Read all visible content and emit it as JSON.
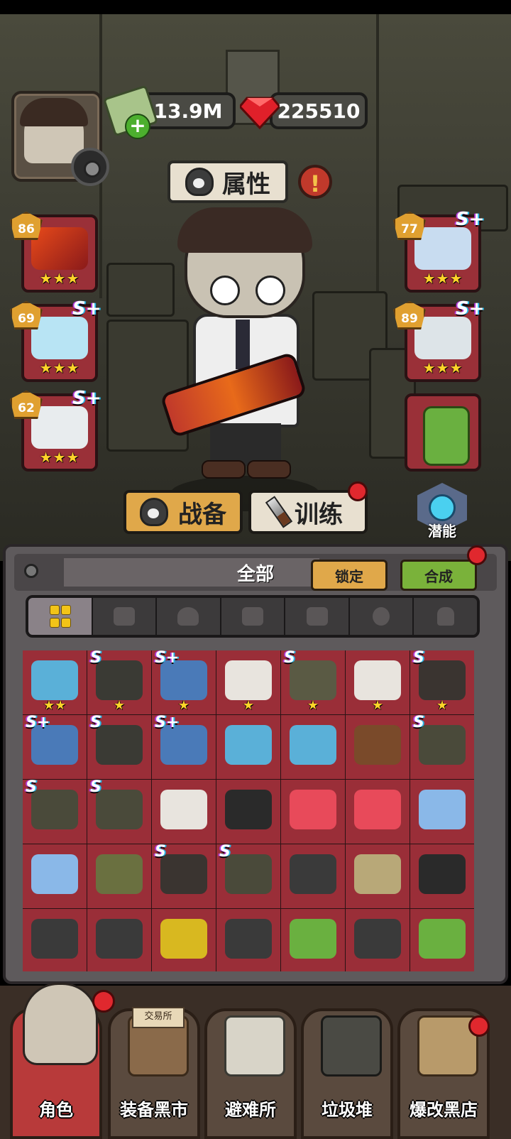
{
  "header": {
    "money": "13.9M",
    "gems": "225510"
  },
  "attributes_button": "属性",
  "equipped": {
    "left": [
      {
        "name": "flame-rifle",
        "level": "86",
        "grade": "",
        "stars": "★★★"
      },
      {
        "name": "visor-helmet",
        "level": "69",
        "grade": "S+",
        "stars": "★★★"
      },
      {
        "name": "white-sneaker",
        "level": "62",
        "grade": "S+",
        "stars": "★★★"
      }
    ],
    "right": [
      {
        "name": "blue-armor",
        "level": "77",
        "grade": "S+",
        "stars": "★★★"
      },
      {
        "name": "white-helmet",
        "level": "89",
        "grade": "S+",
        "stars": "★★★"
      },
      {
        "name": "green-backpack",
        "level": "",
        "grade": "",
        "stars": ""
      }
    ]
  },
  "tabs": {
    "gear": "战备",
    "training": "训练",
    "potential": "潜能"
  },
  "inventory": {
    "title": "全部",
    "lock_button": "锁定",
    "craft_button": "合成",
    "filters": [
      "all",
      "gun",
      "helmet",
      "pants",
      "armor",
      "mask",
      "backpack"
    ],
    "items": [
      {
        "grade": "",
        "stars": "★★",
        "color": "#5ab0d8"
      },
      {
        "grade": "S",
        "stars": "★",
        "color": "#3a3a34"
      },
      {
        "grade": "S+",
        "stars": "★",
        "color": "#4a7ab8"
      },
      {
        "grade": "",
        "stars": "★",
        "color": "#e8e4de"
      },
      {
        "grade": "S",
        "stars": "★",
        "color": "#5a5a44"
      },
      {
        "grade": "",
        "stars": "★",
        "color": "#e8e4de"
      },
      {
        "grade": "S",
        "stars": "★",
        "color": "#3a3430"
      },
      {
        "grade": "S+",
        "stars": "",
        "color": "#4a7ab8"
      },
      {
        "grade": "S",
        "stars": "",
        "color": "#3a3a34"
      },
      {
        "grade": "S+",
        "stars": "",
        "color": "#4a7ab8"
      },
      {
        "grade": "",
        "stars": "",
        "color": "#5ab0d8"
      },
      {
        "grade": "",
        "stars": "",
        "color": "#5ab0d8"
      },
      {
        "grade": "",
        "stars": "",
        "color": "#7a4a2a"
      },
      {
        "grade": "S",
        "stars": "",
        "color": "#4a4a3a"
      },
      {
        "grade": "S",
        "stars": "",
        "color": "#4a4a3a"
      },
      {
        "grade": "S",
        "stars": "",
        "color": "#4a4a3a"
      },
      {
        "grade": "",
        "stars": "",
        "color": "#e8e4de"
      },
      {
        "grade": "",
        "stars": "",
        "color": "#2a2a2a"
      },
      {
        "grade": "",
        "stars": "",
        "color": "#e84a5a"
      },
      {
        "grade": "",
        "stars": "",
        "color": "#e84a5a"
      },
      {
        "grade": "",
        "stars": "",
        "color": "#8ab8e8"
      },
      {
        "grade": "",
        "stars": "",
        "color": "#8ab8e8"
      },
      {
        "grade": "",
        "stars": "",
        "color": "#6a7040"
      },
      {
        "grade": "S",
        "stars": "",
        "color": "#3a3430"
      },
      {
        "grade": "S",
        "stars": "",
        "color": "#4a4a3a"
      },
      {
        "grade": "",
        "stars": "",
        "color": "#3a3a3a"
      },
      {
        "grade": "",
        "stars": "",
        "color": "#b8a878"
      },
      {
        "grade": "",
        "stars": "",
        "color": "#2a2a2a"
      },
      {
        "grade": "",
        "stars": "",
        "color": "#3a3a3a"
      },
      {
        "grade": "",
        "stars": "",
        "color": "#3a3a3a"
      },
      {
        "grade": "",
        "stars": "",
        "color": "#d8b820"
      },
      {
        "grade": "",
        "stars": "",
        "color": "#3a3a3a"
      },
      {
        "grade": "",
        "stars": "",
        "color": "#6ab040"
      },
      {
        "grade": "",
        "stars": "",
        "color": "#3a3a3a"
      },
      {
        "grade": "",
        "stars": "",
        "color": "#6ab040"
      }
    ]
  },
  "bottom_nav": [
    {
      "label": "角色",
      "sign": ""
    },
    {
      "label": "装备黑市",
      "sign": "交易所"
    },
    {
      "label": "避难所",
      "sign": ""
    },
    {
      "label": "垃圾堆",
      "sign": ""
    },
    {
      "label": "爆改黑店",
      "sign": ""
    }
  ],
  "colors": {
    "slot_red": "#9a2e38",
    "lock_btn": "#e0a84a",
    "craft_btn": "#7ab23a",
    "star": "#ffd42a"
  }
}
